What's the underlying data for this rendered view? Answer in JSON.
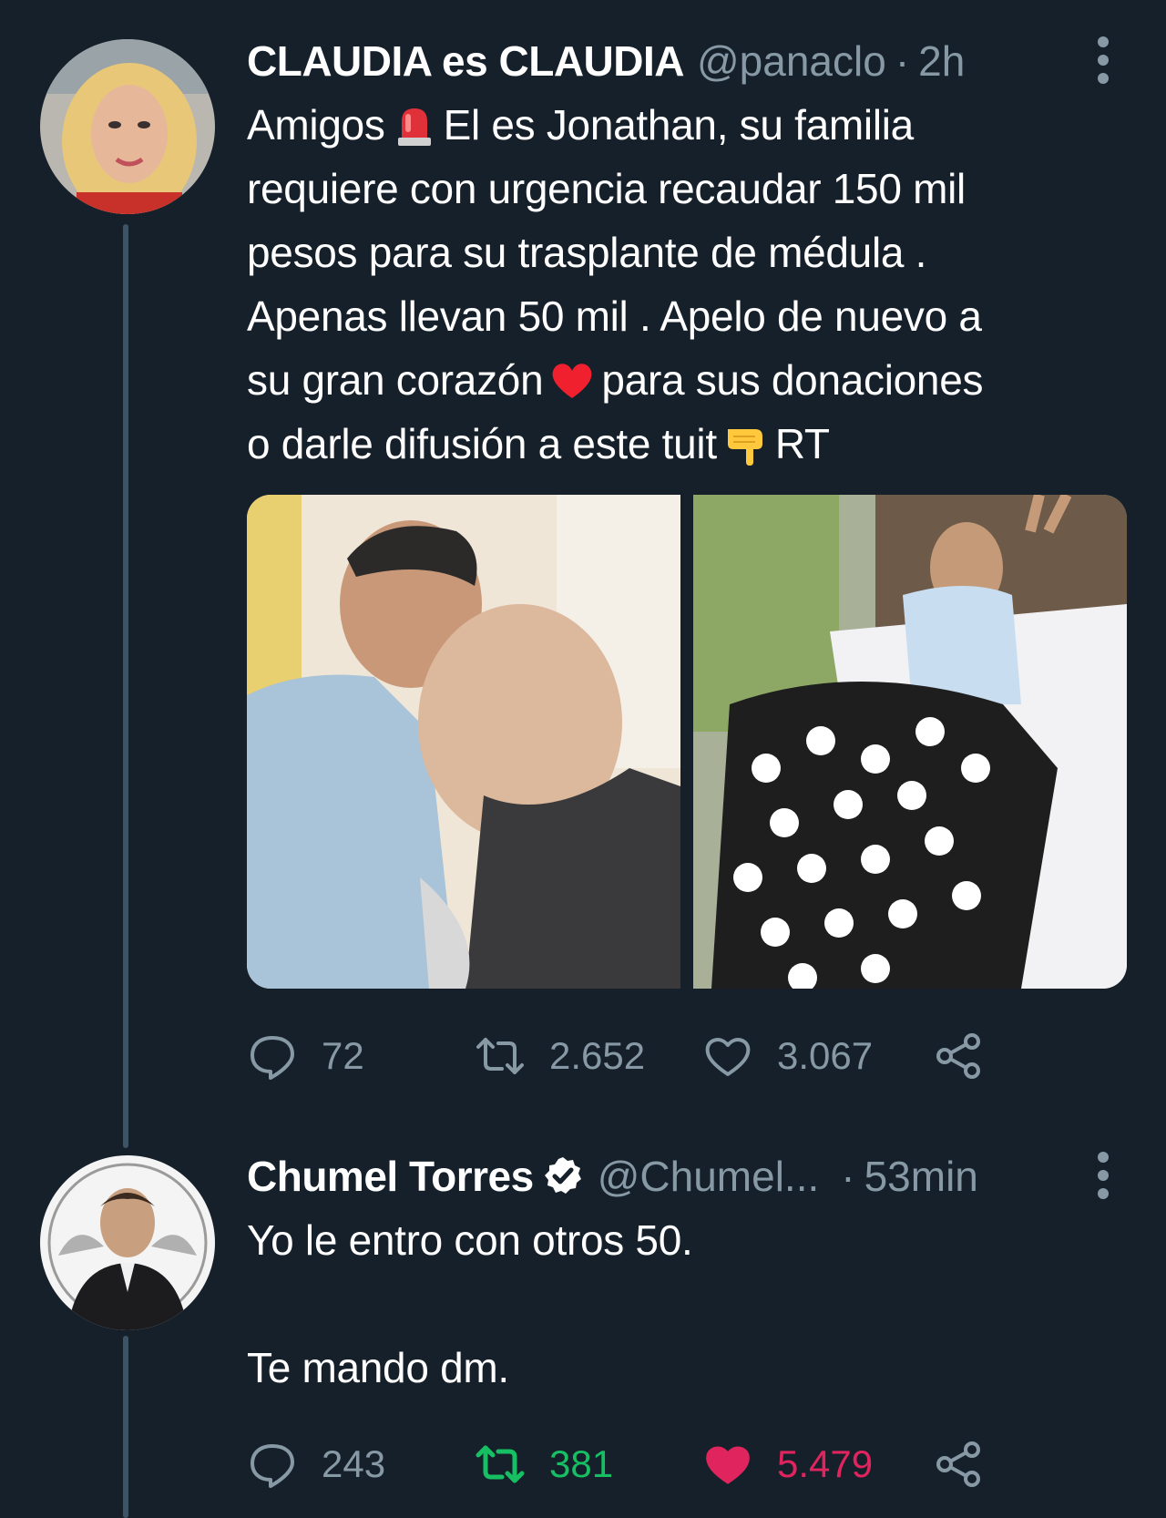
{
  "tweets": [
    {
      "author_name": "CLAUDIA es CLAUDIA",
      "handle": "@panaclo",
      "separator": "·",
      "time": "2h",
      "verified": false,
      "text_parts": {
        "p1": "Amigos",
        "p2": "El es Jonathan, su familia\nrequiere con urgencia recaudar 150 mil\npesos para su trasplante de médula .\nApenas llevan 50 mil . Apelo de nuevo a\nsu gran corazón",
        "p3": "para sus donaciones\no darle difusión a este tuit",
        "p4": "RT"
      },
      "emojis": [
        "siren-icon",
        "red-heart-icon",
        "backhand-pointing-down-icon"
      ],
      "stats": {
        "replies": "72",
        "retweets": "2.652",
        "likes": "3.067"
      },
      "retweeted": false,
      "liked": false
    },
    {
      "author_name": "Chumel Torres",
      "handle": "@Chumel...",
      "separator": "·",
      "time": "53min",
      "verified": true,
      "text": "Yo le entro con otros 50.\n\nTe mando dm.",
      "stats": {
        "replies": "243",
        "retweets": "381",
        "likes": "5.479"
      },
      "retweeted": true,
      "liked": true
    }
  ],
  "colors": {
    "background": "#15202b",
    "secondary_text": "#8899a6",
    "thread_line": "#3d5466",
    "retweet_active": "#17bf63",
    "like_active": "#e0245e",
    "verified_badge": "#ffffff"
  }
}
